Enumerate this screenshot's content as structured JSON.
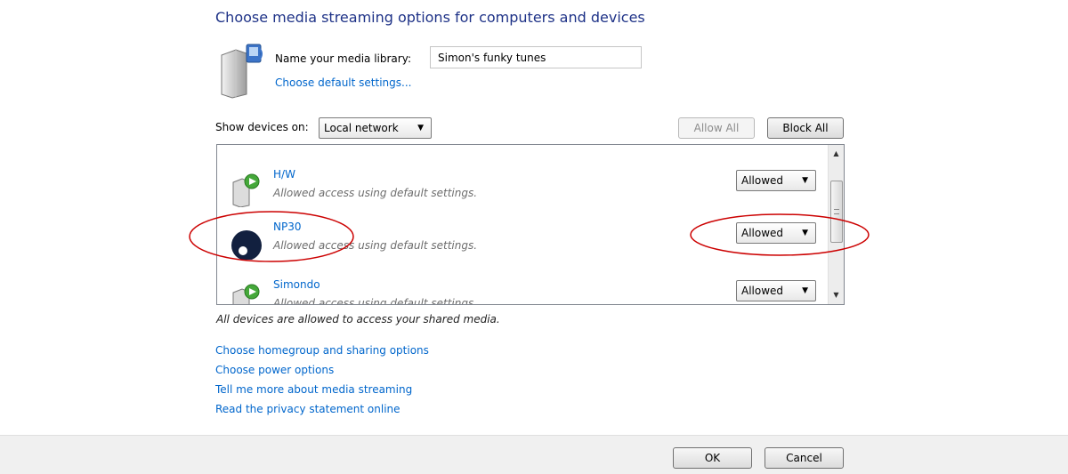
{
  "page": {
    "title": "Choose media streaming options for computers and devices"
  },
  "library": {
    "name_label": "Name your media library:",
    "name_value": "Simon's funky tunes",
    "default_settings_link": "Choose default settings..."
  },
  "filter": {
    "show_devices_label": "Show devices on:",
    "location_value": "Local network"
  },
  "actions": {
    "allow_all": "Allow All",
    "block_all": "Block All"
  },
  "devices": [
    {
      "name": "H/W",
      "description": "Allowed access using default settings.",
      "access": "Allowed",
      "icon": "media-device-icon"
    },
    {
      "name": "NP30",
      "description": "Allowed access using default settings.",
      "access": "Allowed",
      "icon": "np30-device-icon"
    },
    {
      "name": "Simondo",
      "description": "Allowed access using default settings.",
      "access": "Allowed",
      "icon": "media-device-icon"
    }
  ],
  "status_text": "All devices are allowed to access your shared media.",
  "links": [
    "Choose homegroup and sharing options",
    "Choose power options",
    "Tell me more about media streaming",
    "Read the privacy statement online"
  ],
  "footer": {
    "ok": "OK",
    "cancel": "Cancel"
  },
  "colors": {
    "title": "#1e3287",
    "link": "#0066cc",
    "annotation": "#cc0000"
  }
}
